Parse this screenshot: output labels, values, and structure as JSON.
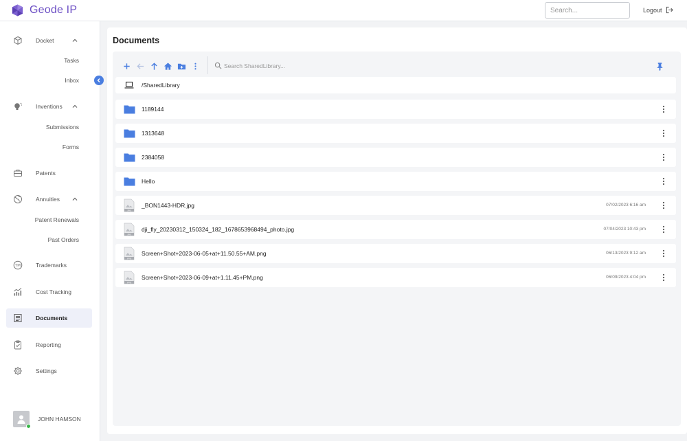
{
  "app": {
    "name": "Geode IP",
    "brand_color": "#6c4fc4"
  },
  "header": {
    "search_placeholder": "Search...",
    "logout_label": "Logout"
  },
  "sidebar": {
    "items": [
      {
        "label": "Docket",
        "icon": "cube-icon",
        "expanded": true,
        "children": [
          "Tasks",
          "Inbox"
        ]
      },
      {
        "label": "Inventions",
        "icon": "lightbulb-icon",
        "expanded": true,
        "children": [
          "Submissions",
          "Forms"
        ]
      },
      {
        "label": "Patents",
        "icon": "briefcase-icon"
      },
      {
        "label": "Annuities",
        "icon": "globe-icon",
        "expanded": true,
        "children": [
          "Patent Renewals",
          "Past Orders"
        ]
      },
      {
        "label": "Trademarks",
        "icon": "trademark-icon"
      },
      {
        "label": "Cost Tracking",
        "icon": "chart-icon"
      },
      {
        "label": "Documents",
        "icon": "document-icon",
        "active": true
      },
      {
        "label": "Reporting",
        "icon": "clipboard-icon"
      },
      {
        "label": "Settings",
        "icon": "gear-icon"
      }
    ],
    "user": {
      "name": "JOHN HAMSON",
      "status_color": "#3bb54a"
    }
  },
  "main": {
    "title": "Documents",
    "search_placeholder": "Search SharedLibrary...",
    "path": "/SharedLibrary",
    "accent_color": "#4a7ee0",
    "entries": [
      {
        "type": "folder",
        "name": "1189144",
        "date": ""
      },
      {
        "type": "folder",
        "name": "1313648",
        "date": ""
      },
      {
        "type": "folder",
        "name": "2384058",
        "date": ""
      },
      {
        "type": "folder",
        "name": "Hello",
        "date": ""
      },
      {
        "type": "file",
        "ext": "jpg",
        "name": "_BON1443-HDR.jpg",
        "date": "07/02/2023 6:16 am"
      },
      {
        "type": "file",
        "ext": "jpg",
        "name": "dji_fly_20230312_150324_182_1678653968494_photo.jpg",
        "date": "07/04/2023 10:43 pm"
      },
      {
        "type": "file",
        "ext": "png",
        "name": "Screen+Shot+2023-06-05+at+11.50.55+AM.png",
        "date": "06/13/2023 9:12 am"
      },
      {
        "type": "file",
        "ext": "png",
        "name": "Screen+Shot+2023-06-09+at+1.11.45+PM.png",
        "date": "06/09/2023 4:04 pm"
      }
    ]
  }
}
